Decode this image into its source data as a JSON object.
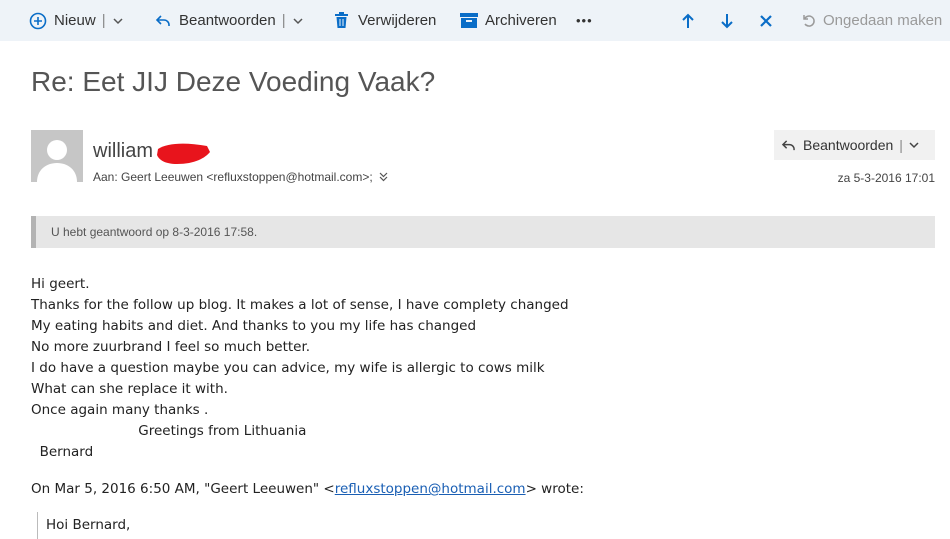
{
  "toolbar": {
    "new_label": "Nieuw",
    "reply_label": "Beantwoorden",
    "delete_label": "Verwijderen",
    "archive_label": "Archiveren",
    "more_label": "•••",
    "undo_label": "Ongedaan maken"
  },
  "message": {
    "subject": "Re: Eet JIJ Deze Voeding Vaak?",
    "sender_name": "william",
    "to_line": "Aan: Geert Leeuwen <refluxstoppen@hotmail.com>;",
    "date": "za 5-3-2016 17:01",
    "reply_button_label": "Beantwoorden",
    "info_bar": "U hebt geantwoord op 8-3-2016 17:58.",
    "body_lines": [
      "Hi geert.",
      "Thanks for the follow up blog. It makes a lot of sense, I have complety changed",
      "My eating habits and diet. And thanks to you my life has changed",
      "No more zuurbrand I feel so much better.",
      "I do have a question maybe you can advice, my wife is allergic to cows milk",
      "What can she replace it with.",
      "Once again many thanks .",
      "                         Greetings from Lithuania",
      "  Bernard"
    ],
    "quote_header_pre": "On Mar 5, 2016 6:50 AM, \"Geert Leeuwen\" <",
    "quote_header_link": "refluxstoppen@hotmail.com",
    "quote_header_post": "> wrote:",
    "quote_first_line": "Hoi Bernard,"
  },
  "colors": {
    "accent": "#0a6dc7",
    "toolbar_bg": "#eef3f8",
    "redaction": "#e8141c",
    "link": "#1a5fb4"
  },
  "icons": {
    "new": "plus-circle-icon",
    "reply": "reply-arrow-icon",
    "delete": "trash-icon",
    "archive": "archive-box-icon",
    "prev": "arrow-up-icon",
    "next": "arrow-down-icon",
    "close": "close-icon",
    "undo": "undo-icon"
  }
}
